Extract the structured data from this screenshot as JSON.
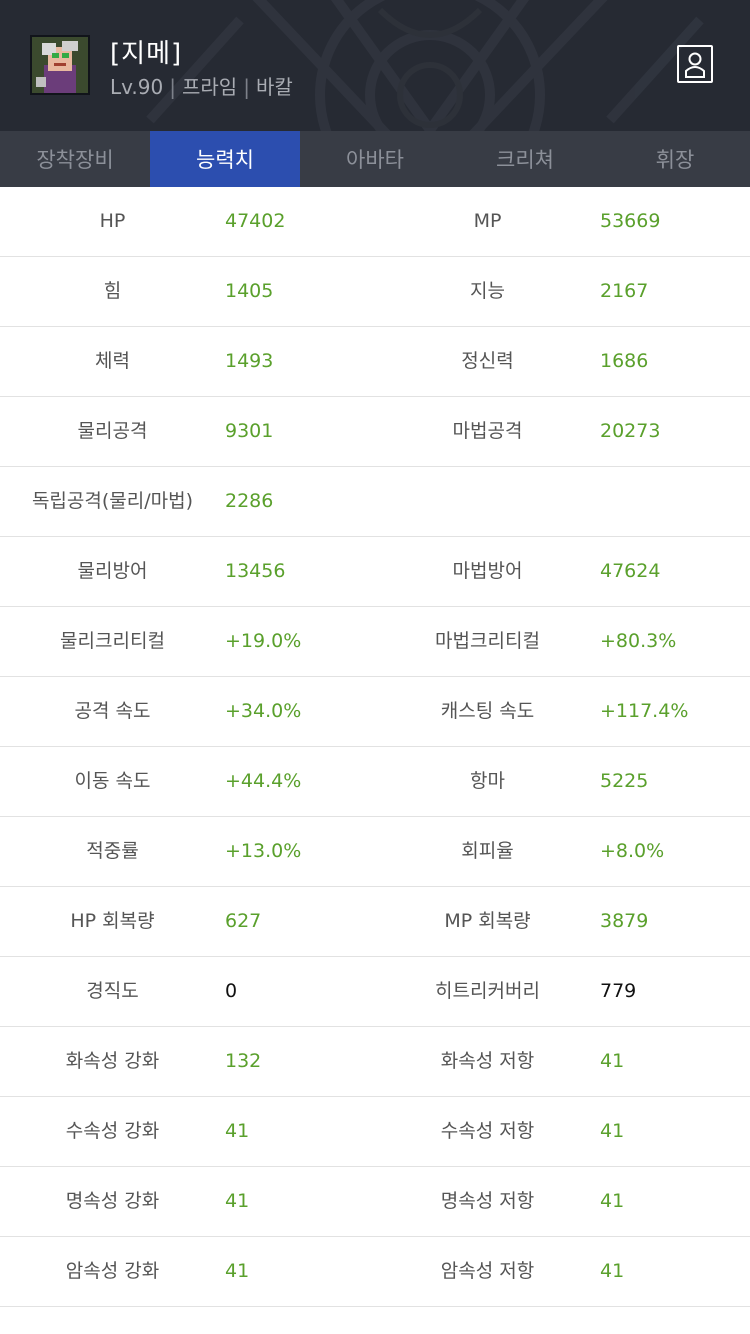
{
  "header": {
    "name": "[지메]",
    "level": "Lv.90",
    "job": "프라임",
    "server": "바칼",
    "separator": "|",
    "avatar_icon": "character-portrait-icon",
    "profile_icon": "user-profile-icon"
  },
  "tabs": [
    {
      "label": "장착장비",
      "active": false
    },
    {
      "label": "능력치",
      "active": true
    },
    {
      "label": "아바타",
      "active": false
    },
    {
      "label": "크리쳐",
      "active": false
    },
    {
      "label": "휘장",
      "active": false
    }
  ],
  "colors": {
    "accent": "#2c4eaf",
    "value_green": "#5aa02c",
    "header_bg": "#262a33"
  },
  "stats": [
    {
      "l1": "HP",
      "v1": "47402",
      "l2": "MP",
      "v2": "53669"
    },
    {
      "l1": "힘",
      "v1": "1405",
      "l2": "지능",
      "v2": "2167"
    },
    {
      "l1": "체력",
      "v1": "1493",
      "l2": "정신력",
      "v2": "1686"
    },
    {
      "l1": "물리공격",
      "v1": "9301",
      "l2": "마법공격",
      "v2": "20273"
    },
    {
      "l1": "독립공격(물리/마법)",
      "v1": "2286",
      "l2": "",
      "v2": ""
    },
    {
      "l1": "물리방어",
      "v1": "13456",
      "l2": "마법방어",
      "v2": "47624"
    },
    {
      "l1": "물리크리티컬",
      "v1": "+19.0%",
      "l2": "마법크리티컬",
      "v2": "+80.3%"
    },
    {
      "l1": "공격 속도",
      "v1": "+34.0%",
      "l2": "캐스팅 속도",
      "v2": "+117.4%"
    },
    {
      "l1": "이동 속도",
      "v1": "+44.4%",
      "l2": "항마",
      "v2": "5225"
    },
    {
      "l1": "적중률",
      "v1": "+13.0%",
      "l2": "회피율",
      "v2": "+8.0%"
    },
    {
      "l1": "HP 회복량",
      "v1": "627",
      "l2": "MP 회복량",
      "v2": "3879"
    },
    {
      "l1": "경직도",
      "v1": "0",
      "l2": "히트리커버리",
      "v2": "779"
    },
    {
      "l1": "화속성 강화",
      "v1": "132",
      "l2": "화속성 저항",
      "v2": "41"
    },
    {
      "l1": "수속성 강화",
      "v1": "41",
      "l2": "수속성 저항",
      "v2": "41"
    },
    {
      "l1": "명속성 강화",
      "v1": "41",
      "l2": "명속성 저항",
      "v2": "41"
    },
    {
      "l1": "암속성 강화",
      "v1": "41",
      "l2": "암속성 저항",
      "v2": "41"
    }
  ]
}
